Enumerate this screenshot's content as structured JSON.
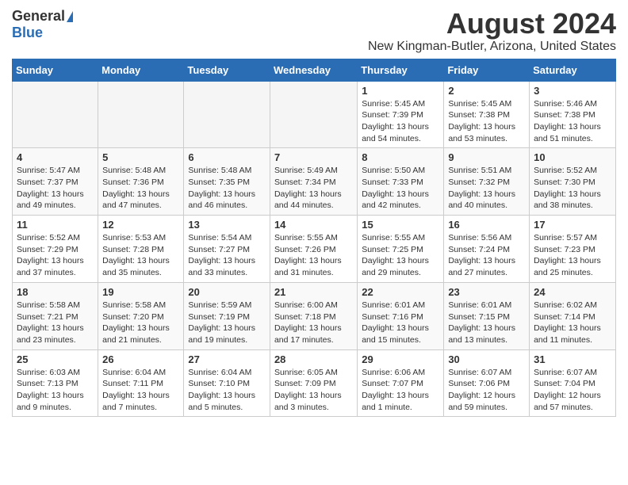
{
  "header": {
    "logo_general": "General",
    "logo_blue": "Blue",
    "main_title": "August 2024",
    "subtitle": "New Kingman-Butler, Arizona, United States"
  },
  "calendar": {
    "days_of_week": [
      "Sunday",
      "Monday",
      "Tuesday",
      "Wednesday",
      "Thursday",
      "Friday",
      "Saturday"
    ],
    "weeks": [
      [
        {
          "day": "",
          "info": ""
        },
        {
          "day": "",
          "info": ""
        },
        {
          "day": "",
          "info": ""
        },
        {
          "day": "",
          "info": ""
        },
        {
          "day": "1",
          "info": "Sunrise: 5:45 AM\nSunset: 7:39 PM\nDaylight: 13 hours and 54 minutes."
        },
        {
          "day": "2",
          "info": "Sunrise: 5:45 AM\nSunset: 7:38 PM\nDaylight: 13 hours and 53 minutes."
        },
        {
          "day": "3",
          "info": "Sunrise: 5:46 AM\nSunset: 7:38 PM\nDaylight: 13 hours and 51 minutes."
        }
      ],
      [
        {
          "day": "4",
          "info": "Sunrise: 5:47 AM\nSunset: 7:37 PM\nDaylight: 13 hours and 49 minutes."
        },
        {
          "day": "5",
          "info": "Sunrise: 5:48 AM\nSunset: 7:36 PM\nDaylight: 13 hours and 47 minutes."
        },
        {
          "day": "6",
          "info": "Sunrise: 5:48 AM\nSunset: 7:35 PM\nDaylight: 13 hours and 46 minutes."
        },
        {
          "day": "7",
          "info": "Sunrise: 5:49 AM\nSunset: 7:34 PM\nDaylight: 13 hours and 44 minutes."
        },
        {
          "day": "8",
          "info": "Sunrise: 5:50 AM\nSunset: 7:33 PM\nDaylight: 13 hours and 42 minutes."
        },
        {
          "day": "9",
          "info": "Sunrise: 5:51 AM\nSunset: 7:32 PM\nDaylight: 13 hours and 40 minutes."
        },
        {
          "day": "10",
          "info": "Sunrise: 5:52 AM\nSunset: 7:30 PM\nDaylight: 13 hours and 38 minutes."
        }
      ],
      [
        {
          "day": "11",
          "info": "Sunrise: 5:52 AM\nSunset: 7:29 PM\nDaylight: 13 hours and 37 minutes."
        },
        {
          "day": "12",
          "info": "Sunrise: 5:53 AM\nSunset: 7:28 PM\nDaylight: 13 hours and 35 minutes."
        },
        {
          "day": "13",
          "info": "Sunrise: 5:54 AM\nSunset: 7:27 PM\nDaylight: 13 hours and 33 minutes."
        },
        {
          "day": "14",
          "info": "Sunrise: 5:55 AM\nSunset: 7:26 PM\nDaylight: 13 hours and 31 minutes."
        },
        {
          "day": "15",
          "info": "Sunrise: 5:55 AM\nSunset: 7:25 PM\nDaylight: 13 hours and 29 minutes."
        },
        {
          "day": "16",
          "info": "Sunrise: 5:56 AM\nSunset: 7:24 PM\nDaylight: 13 hours and 27 minutes."
        },
        {
          "day": "17",
          "info": "Sunrise: 5:57 AM\nSunset: 7:23 PM\nDaylight: 13 hours and 25 minutes."
        }
      ],
      [
        {
          "day": "18",
          "info": "Sunrise: 5:58 AM\nSunset: 7:21 PM\nDaylight: 13 hours and 23 minutes."
        },
        {
          "day": "19",
          "info": "Sunrise: 5:58 AM\nSunset: 7:20 PM\nDaylight: 13 hours and 21 minutes."
        },
        {
          "day": "20",
          "info": "Sunrise: 5:59 AM\nSunset: 7:19 PM\nDaylight: 13 hours and 19 minutes."
        },
        {
          "day": "21",
          "info": "Sunrise: 6:00 AM\nSunset: 7:18 PM\nDaylight: 13 hours and 17 minutes."
        },
        {
          "day": "22",
          "info": "Sunrise: 6:01 AM\nSunset: 7:16 PM\nDaylight: 13 hours and 15 minutes."
        },
        {
          "day": "23",
          "info": "Sunrise: 6:01 AM\nSunset: 7:15 PM\nDaylight: 13 hours and 13 minutes."
        },
        {
          "day": "24",
          "info": "Sunrise: 6:02 AM\nSunset: 7:14 PM\nDaylight: 13 hours and 11 minutes."
        }
      ],
      [
        {
          "day": "25",
          "info": "Sunrise: 6:03 AM\nSunset: 7:13 PM\nDaylight: 13 hours and 9 minutes."
        },
        {
          "day": "26",
          "info": "Sunrise: 6:04 AM\nSunset: 7:11 PM\nDaylight: 13 hours and 7 minutes."
        },
        {
          "day": "27",
          "info": "Sunrise: 6:04 AM\nSunset: 7:10 PM\nDaylight: 13 hours and 5 minutes."
        },
        {
          "day": "28",
          "info": "Sunrise: 6:05 AM\nSunset: 7:09 PM\nDaylight: 13 hours and 3 minutes."
        },
        {
          "day": "29",
          "info": "Sunrise: 6:06 AM\nSunset: 7:07 PM\nDaylight: 13 hours and 1 minute."
        },
        {
          "day": "30",
          "info": "Sunrise: 6:07 AM\nSunset: 7:06 PM\nDaylight: 12 hours and 59 minutes."
        },
        {
          "day": "31",
          "info": "Sunrise: 6:07 AM\nSunset: 7:04 PM\nDaylight: 12 hours and 57 minutes."
        }
      ]
    ]
  }
}
